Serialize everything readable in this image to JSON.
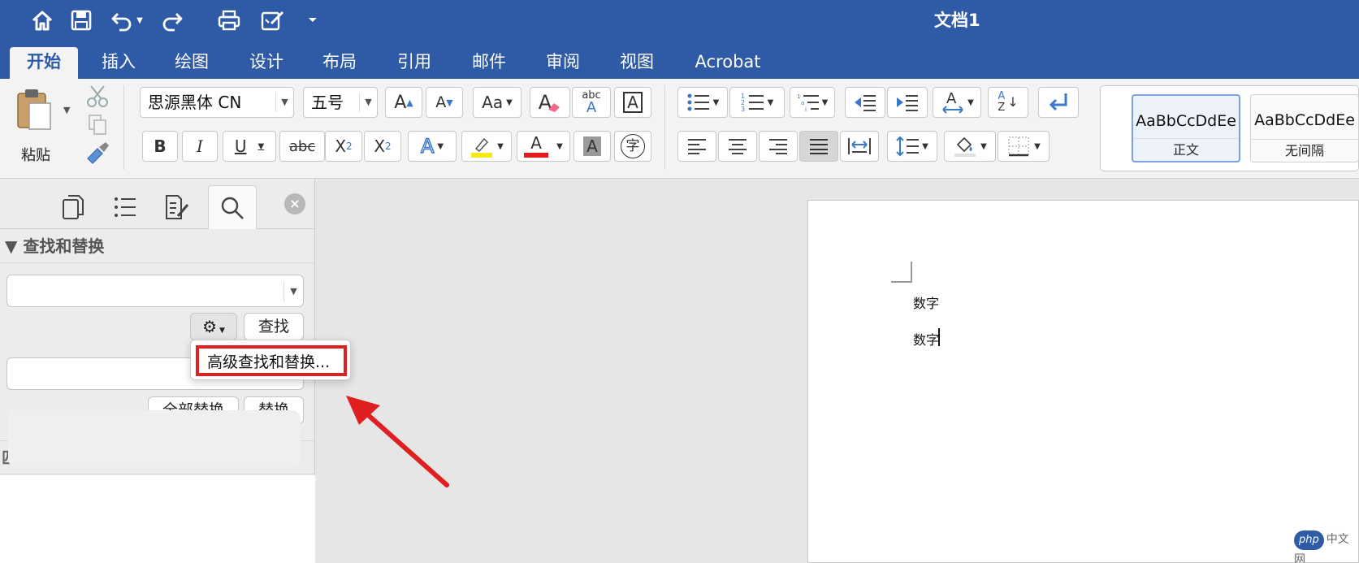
{
  "app": {
    "document_title": "文档1"
  },
  "quick_access": [
    "home-icon",
    "save-icon",
    "undo-icon",
    "redo-icon",
    "print-icon",
    "edit-icon",
    "customize-icon"
  ],
  "tabs": [
    {
      "label": "开始",
      "active": true
    },
    {
      "label": "插入"
    },
    {
      "label": "绘图"
    },
    {
      "label": "设计"
    },
    {
      "label": "布局"
    },
    {
      "label": "引用"
    },
    {
      "label": "邮件"
    },
    {
      "label": "审阅"
    },
    {
      "label": "视图"
    },
    {
      "label": "Acrobat"
    }
  ],
  "ribbon": {
    "paste_label": "粘贴",
    "font_name": "思源黑体 CN",
    "font_size": "五号",
    "bold": "B",
    "italic": "I",
    "underline": "U",
    "strike": "abc",
    "subscript_base": "X",
    "subscript_mark": "2",
    "superscript_base": "X",
    "superscript_mark": "2",
    "grow_font": "A",
    "shrink_font": "A",
    "change_case": "Aa",
    "clear_format": "A",
    "phonetic_top": "abc",
    "phonetic_bottom": "A",
    "char_border": "A",
    "text_effect": "A",
    "font_color": "A",
    "char_shading": "A",
    "enclose_char": "字",
    "sort_top": "A",
    "sort_bottom": "Z",
    "styles": [
      {
        "sample": "AaBbCcDdEe",
        "name": "正文",
        "selected": true
      },
      {
        "sample": "AaBbCcDdEe",
        "name": "无间隔"
      }
    ],
    "colors": {
      "highlight": "#f7e81a",
      "font_color": "#e21b1b",
      "accent": "#2e5aa6",
      "shading": "#9a9a9a"
    }
  },
  "pane": {
    "section_title": "▼ 查找和替换",
    "find_value": "",
    "replace_value": "",
    "find_button": "查找",
    "replace_all_button": "全部替换",
    "replace_button": "替换",
    "matches_label": "匹配项:",
    "dropdown_item": "高级查找和替换..."
  },
  "document": {
    "lines": [
      "数字",
      "数字"
    ]
  },
  "watermark": {
    "badge": "php",
    "text": "中文网"
  }
}
